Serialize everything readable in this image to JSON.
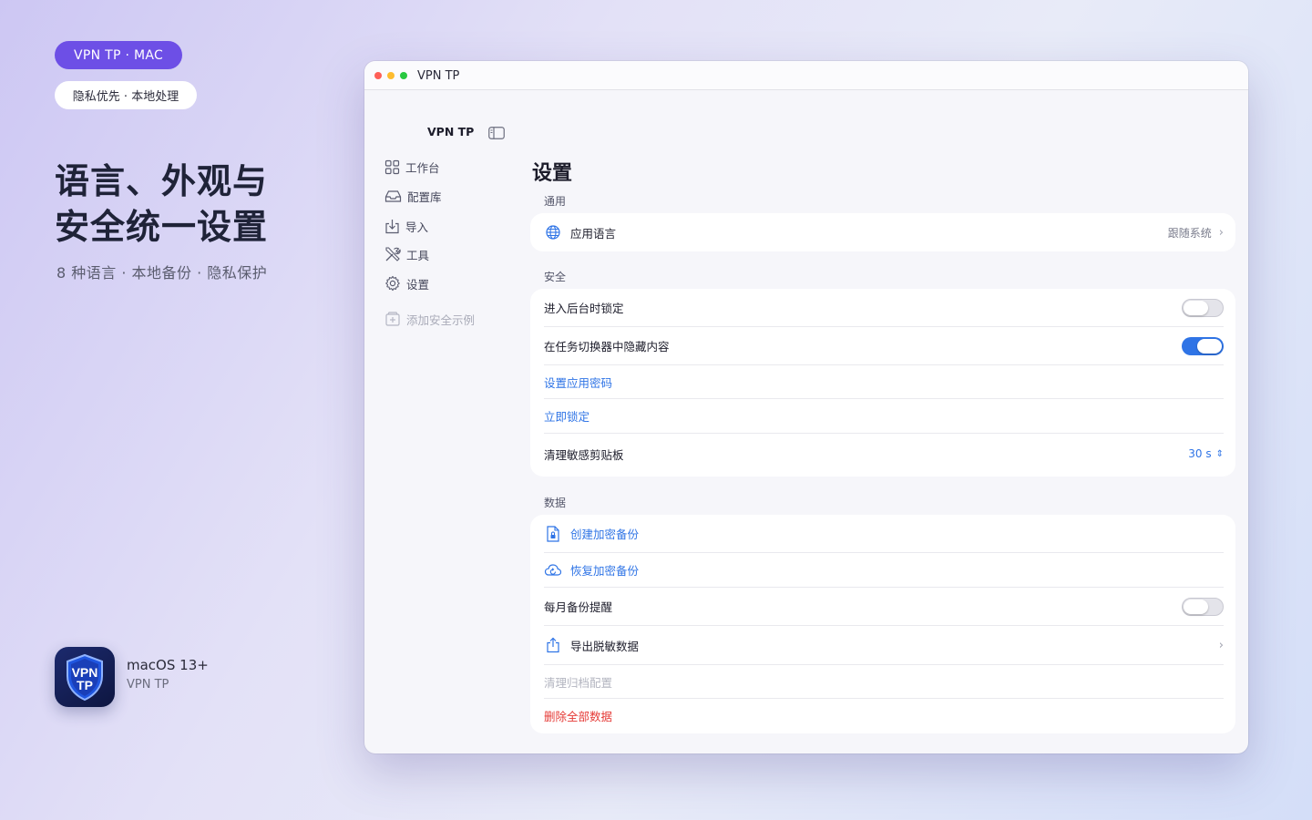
{
  "promo": {
    "platform_pill": "VPN TP · MAC",
    "privacy_pill": "隐私优先 · 本地处理",
    "headline_line1": "语言、外观与",
    "headline_line2": "安全统一设置",
    "subline": "8 种语言 · 本地备份 · 隐私保护",
    "app_requirement": "macOS 13+",
    "app_name": "VPN TP",
    "icon_text_top": "VPN",
    "icon_text_bottom": "TP"
  },
  "window": {
    "title": "VPN TP"
  },
  "sidebar": {
    "app_name": "VPN TP",
    "items": [
      {
        "label": "工作台",
        "icon": "grid-icon"
      },
      {
        "label": "配置库",
        "icon": "tray-icon"
      },
      {
        "label": "导入",
        "icon": "import-icon"
      },
      {
        "label": "工具",
        "icon": "tools-icon"
      },
      {
        "label": "设置",
        "icon": "gear-icon"
      }
    ],
    "add_sample": "添加安全示例"
  },
  "settings": {
    "title": "设置",
    "general": {
      "label": "通用",
      "app_language": "应用语言",
      "app_language_value": "跟随系统"
    },
    "security": {
      "label": "安全",
      "lock_on_background": "进入后台时锁定",
      "lock_on_background_enabled": false,
      "hide_in_switcher": "在任务切换器中隐藏内容",
      "hide_in_switcher_enabled": true,
      "set_password": "设置应用密码",
      "lock_now": "立即锁定",
      "clear_clipboard": "清理敏感剪贴板",
      "clear_clipboard_value": "30 s"
    },
    "data": {
      "label": "数据",
      "create_backup": "创建加密备份",
      "restore_backup": "恢复加密备份",
      "monthly_reminder": "每月备份提醒",
      "monthly_reminder_enabled": false,
      "export_data": "导出脱敏数据",
      "clear_archive": "清理归档配置",
      "delete_all": "删除全部数据"
    }
  },
  "colors": {
    "accent": "#2f74e6",
    "brand_purple": "#6d4fe6",
    "danger": "#e53935"
  }
}
